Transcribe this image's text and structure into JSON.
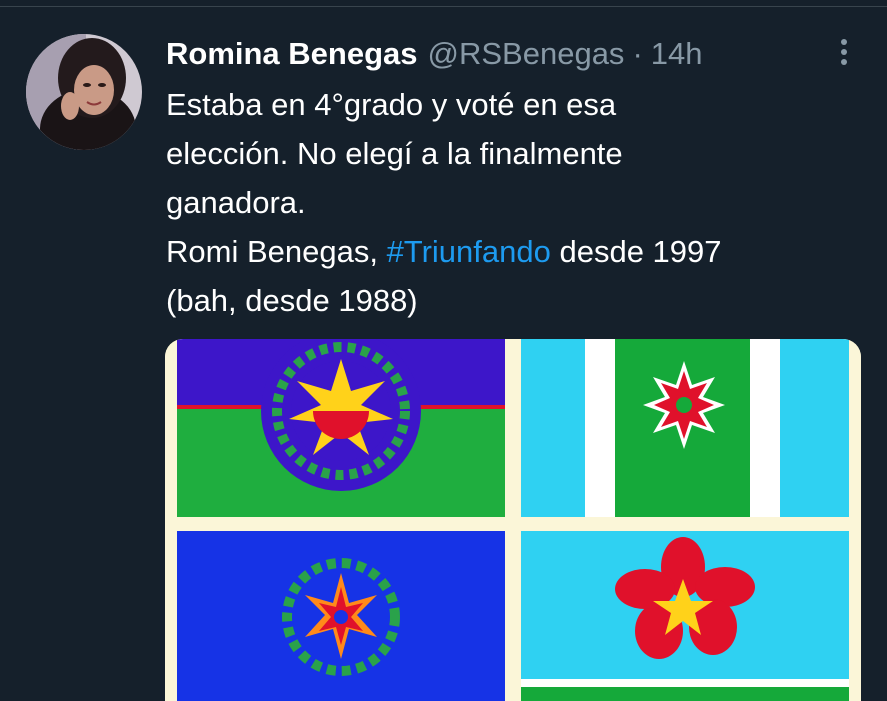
{
  "tweet": {
    "display_name": "Romina Benegas",
    "handle": "@RSBenegas",
    "separator": "·",
    "time": "14h",
    "text_lines": [
      "Estaba en 4°grado y voté en esa",
      "elección. No elegí a la finalmente",
      "ganadora."
    ],
    "line4_prefix": "Romi Benegas, ",
    "hashtag": "#Triunfando",
    "line4_suffix": " desde 1997",
    "line5": "(bah, desde 1988)"
  },
  "icons": {
    "more": "more-vertical-icon",
    "avatar": "profile-photo"
  },
  "media": {
    "description_icons": [
      "flag-sun-blue-green",
      "flag-red-star-cyan-green",
      "flag-star-wreath-blue",
      "flag-red-flower-cyan"
    ]
  },
  "colors": {
    "background": "#15202b",
    "text": "#ffffff",
    "secondary": "#8899a6",
    "link": "#1d9bf0"
  }
}
